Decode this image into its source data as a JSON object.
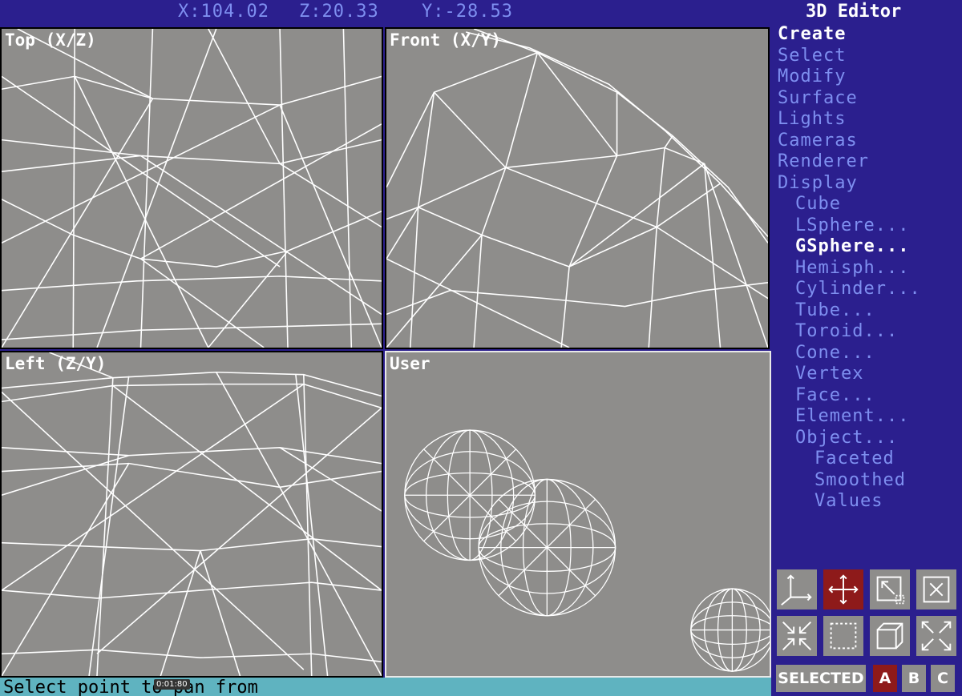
{
  "header": {
    "coord_x": "X:104.02",
    "coord_z": "Z:20.33",
    "coord_y": "Y:-28.53",
    "app_title": "3D Editor"
  },
  "viewports": {
    "top": "Top (X/Z)",
    "front": "Front (X/Y)",
    "left": "Left (Z/Y)",
    "user": "User"
  },
  "menu": {
    "items": [
      {
        "label": "Create",
        "level": 0,
        "active": true
      },
      {
        "label": "Select",
        "level": 0
      },
      {
        "label": "Modify",
        "level": 0
      },
      {
        "label": "Surface",
        "level": 0
      },
      {
        "label": "Lights",
        "level": 0
      },
      {
        "label": "Cameras",
        "level": 0
      },
      {
        "label": "Renderer",
        "level": 0
      },
      {
        "label": "Display",
        "level": 0
      },
      {
        "label": "Cube",
        "level": 1
      },
      {
        "label": "LSphere...",
        "level": 1
      },
      {
        "label": "GSphere...",
        "level": 1,
        "active": true
      },
      {
        "label": "Hemisph...",
        "level": 1
      },
      {
        "label": "Cylinder...",
        "level": 1
      },
      {
        "label": "Tube...",
        "level": 1
      },
      {
        "label": "Toroid...",
        "level": 1
      },
      {
        "label": "Cone...",
        "level": 1
      },
      {
        "label": "Vertex",
        "level": 1
      },
      {
        "label": "Face...",
        "level": 1
      },
      {
        "label": "Element...",
        "level": 1
      },
      {
        "label": "Object...",
        "level": 1
      },
      {
        "label": "Faceted",
        "level": 2
      },
      {
        "label": "Smoothed",
        "level": 2
      },
      {
        "label": "Values",
        "level": 2
      }
    ]
  },
  "toolbar": {
    "icons": [
      "axis-icon",
      "pan-move-icon",
      "zoom-region-icon",
      "zoom-extents-icon",
      "zoom-in-icon",
      "region-select-icon",
      "cube-view-icon",
      "fullscreen-icon"
    ],
    "selected_label": "SELECTED",
    "a_label": "A",
    "b_label": "B",
    "c_label": "C"
  },
  "status": {
    "text": "Select point to pan from",
    "timer": "0:01:80"
  },
  "colors": {
    "background": "#2b1f8e",
    "menu_text": "#7e8ff0",
    "viewport_bg": "#8e8d8b",
    "active_button": "#8e1a1a",
    "status_bar": "#5fb3c0"
  }
}
